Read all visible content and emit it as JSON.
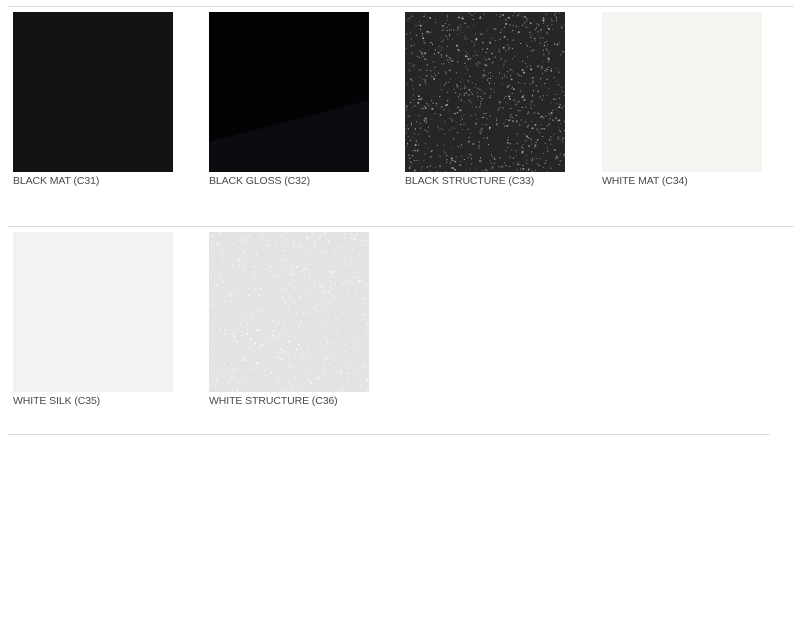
{
  "swatches": [
    {
      "label": "BLACK MAT (C31)",
      "color": "#111311",
      "finish": "matte"
    },
    {
      "label": "BLACK GLOSS (C32)",
      "color": "#030305",
      "finish": "gloss"
    },
    {
      "label": "BLACK STRUCTURE (C33)",
      "color": "#262626",
      "finish": "structure",
      "speck_color": "#bdbdbd"
    },
    {
      "label": "WHITE MAT (C34)",
      "color": "#f4f4f0",
      "finish": "matte"
    },
    {
      "label": "WHITE SILK (C35)",
      "color": "#f2f2f5",
      "finish": "silk"
    },
    {
      "label": "WHITE STRUCTURE (C36)",
      "color": "#e2e3e2",
      "finish": "structure",
      "speck_color": "#ffffff"
    }
  ],
  "colors": {
    "divider": "#dddddd",
    "label_text": "#4a4a4a"
  }
}
